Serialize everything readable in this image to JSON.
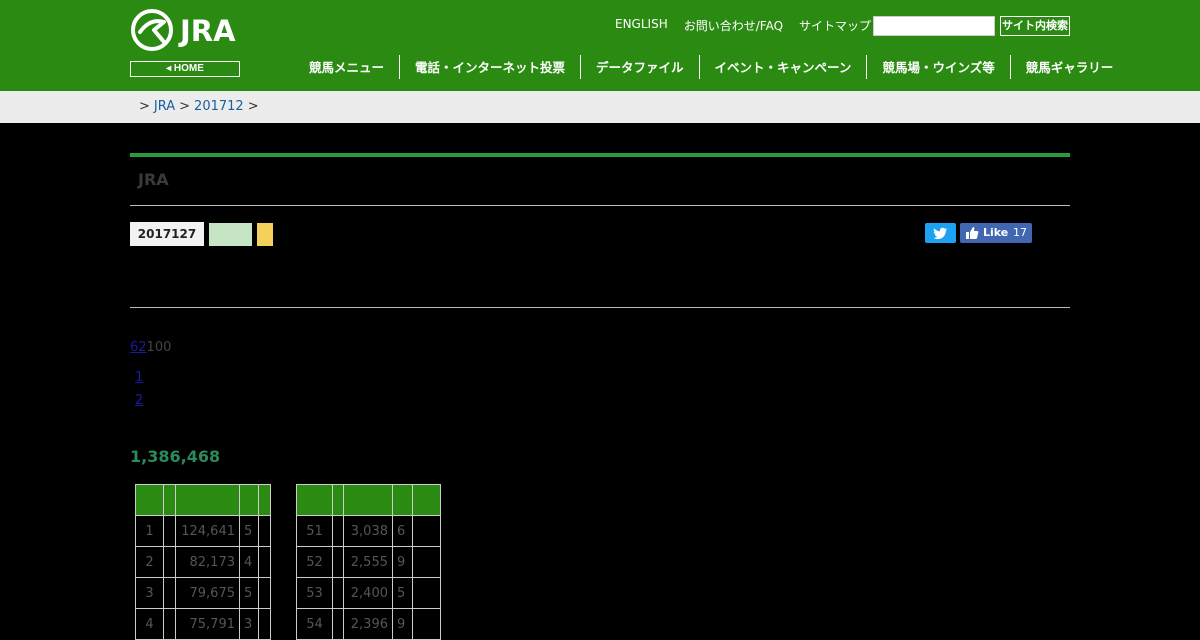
{
  "header": {
    "logo_text": "JRA",
    "home_label": "◂ HOME",
    "util_links": [
      "ENGLISH",
      "お問い合わせ/FAQ",
      "サイトマップ"
    ],
    "search_placeholder": "",
    "search_button": "サイト内検索",
    "nav": [
      "競馬メニュー",
      "電話・インターネット投票",
      "データファイル",
      "イベント・キャンペーン",
      "競馬場・ウインズ等",
      "競馬ギャラリー"
    ]
  },
  "breadcrumb": {
    "items": [
      "JRA",
      "201712"
    ]
  },
  "page": {
    "title": "JRA",
    "date": "2017127",
    "social": {
      "twitter_icon": "twitter-bird-icon",
      "fb_label": "Like",
      "fb_count": "17"
    },
    "count_link": "62",
    "count_rest": "100",
    "page_links": [
      "1",
      "2"
    ],
    "total": "1,386,468"
  },
  "colors": {
    "header_green": "#2a8a12",
    "accent_green": "#2a9a3a",
    "total_green": "#2a8a5a",
    "tag_green": "#c5e5c5",
    "tag_yellow": "#f5d05a",
    "twitter_blue": "#1da1f2",
    "facebook_blue": "#4267b2"
  },
  "table_left": {
    "rows": [
      [
        "1",
        "124,641",
        "5"
      ],
      [
        "2",
        "82,173",
        "4"
      ],
      [
        "3",
        "79,675",
        "5"
      ],
      [
        "4",
        "75,791",
        "3"
      ]
    ]
  },
  "table_right": {
    "rows": [
      [
        "51",
        "3,038",
        "6"
      ],
      [
        "52",
        "2,555",
        "9"
      ],
      [
        "53",
        "2,400",
        "5"
      ],
      [
        "54",
        "2,396",
        "9"
      ]
    ]
  }
}
